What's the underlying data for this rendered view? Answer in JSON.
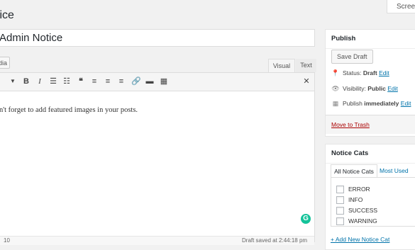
{
  "header": {
    "screen_options": "Screen",
    "page_title": "tice"
  },
  "editor": {
    "post_title": "Admin Notice",
    "add_media": "dia",
    "tab_visual": "Visual",
    "tab_text": "Text",
    "content": "n't forget to add featured images in your posts.",
    "word_count": "10",
    "draft_saved": "Draft saved at 2:44:18 pm",
    "grammarly": "G"
  },
  "publish": {
    "title": "Publish",
    "save_draft": "Save Draft",
    "status_label": "Status:",
    "status_value": "Draft",
    "visibility_label": "Visibility:",
    "visibility_value": "Public",
    "publish_label": "Publish",
    "publish_value": "immediately",
    "edit_link": "Edit",
    "move_to_trash": "Move to Trash"
  },
  "notice_cats": {
    "title": "Notice Cats",
    "tab_all": "All Notice Cats",
    "tab_most_used": "Most Used",
    "items": [
      "ERROR",
      "INFO",
      "SUCCESS",
      "WARNING"
    ],
    "add_new": "+ Add New Notice Cat"
  },
  "colors": {
    "link": "#0073aa",
    "trash": "#a00",
    "grammarly": "#15c39a"
  }
}
